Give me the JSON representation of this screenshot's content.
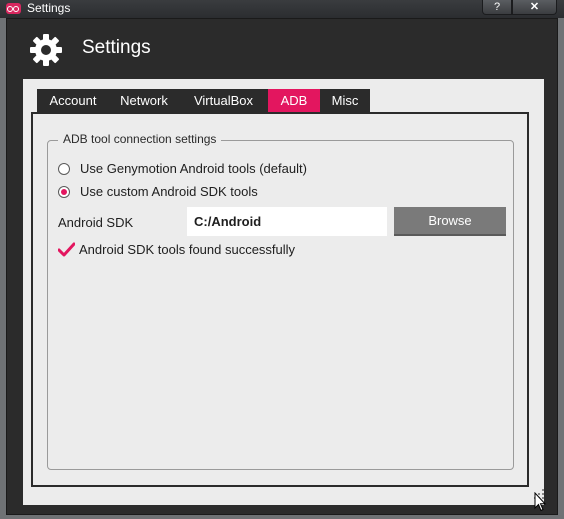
{
  "window": {
    "title": "Settings",
    "help_label": "?",
    "close_label": "✕"
  },
  "header": {
    "title": "Settings",
    "icon": "gear-icon"
  },
  "tabs": [
    {
      "label": "Account",
      "active": false
    },
    {
      "label": "Network",
      "active": false
    },
    {
      "label": "VirtualBox",
      "active": false
    },
    {
      "label": "ADB",
      "active": true
    },
    {
      "label": "Misc",
      "active": false
    }
  ],
  "adb": {
    "group_title": "ADB tool connection settings",
    "option_genymotion": "Use Genymotion Android tools (default)",
    "option_custom": "Use custom Android SDK tools",
    "selected_option": "custom",
    "sdk_label": "Android SDK",
    "sdk_path": "C:/Android",
    "browse_label": "Browse",
    "status_text": "Android SDK tools found successfully"
  },
  "colors": {
    "accent": "#e3165f",
    "frame": "#2b2b2b",
    "panel": "#ececec",
    "button": "#7a7a7a"
  }
}
